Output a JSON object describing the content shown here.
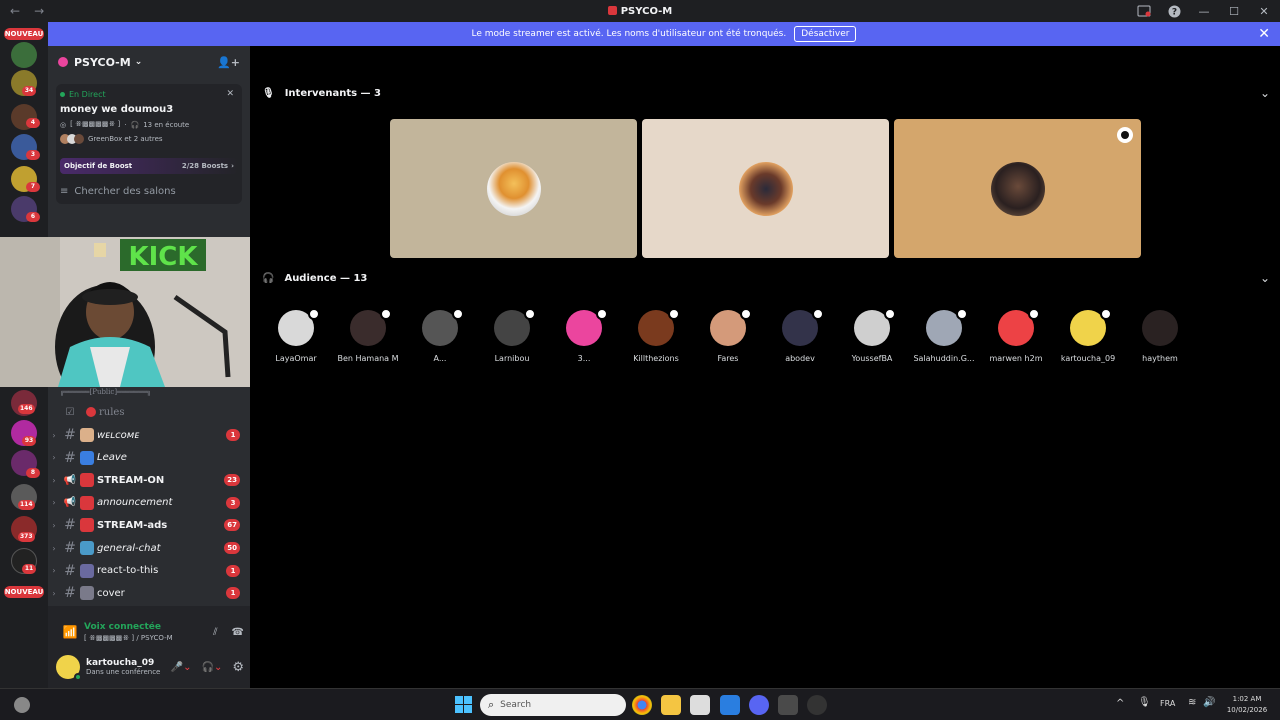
{
  "window": {
    "title": "PSYCO-M"
  },
  "banner": {
    "text": "Le mode streamer est activé. Les noms d'utilisateur ont été tronqués.",
    "button": "Désactiver"
  },
  "guilds": {
    "new_top": "NOUVEAU",
    "new_bottom": "NOUVEAU",
    "badges": [
      "34",
      "4",
      "3",
      "7",
      "6",
      "146",
      "93",
      "8",
      "114",
      "373",
      "11"
    ]
  },
  "server": {
    "name": "PSYCO-M"
  },
  "live": {
    "status": "En Direct",
    "stage_name": "money we doumou3",
    "channel": "[ ꗥ▩▩▩▩ꗥ ]",
    "listeners": "13 en écoute",
    "attendees": "GreenBox et 2 autres"
  },
  "boost": {
    "label": "Objectif de Boost",
    "count": "2/28 Boosts"
  },
  "search": {
    "placeholder": "Chercher des salons"
  },
  "category": "╔══════[Public]═══════╗",
  "rules": "rules",
  "channels": [
    {
      "name": "ᴡᴇʟᴄᴏᴍᴇ",
      "badge": "1",
      "type": "text",
      "style": "italic"
    },
    {
      "name": "Leave",
      "badge": "",
      "type": "text",
      "style": "italic"
    },
    {
      "name": "STREAM-ON",
      "badge": "23",
      "type": "announce",
      "style": "bold"
    },
    {
      "name": "announcement",
      "badge": "3",
      "type": "announce",
      "style": "italic"
    },
    {
      "name": "STREAM-ads",
      "badge": "67",
      "type": "text",
      "style": "bold"
    },
    {
      "name": "general-chat",
      "badge": "50",
      "type": "text",
      "style": "italic"
    },
    {
      "name": "react-to-this",
      "badge": "1",
      "type": "text",
      "style": "normal"
    },
    {
      "name": "cover",
      "badge": "1",
      "type": "text",
      "style": "normal"
    }
  ],
  "voice": {
    "status": "Voix connectée",
    "location": "[ ꗥ▩▩▩▩ꗥ ] / PSYCO-M"
  },
  "user": {
    "name": "kartoucha_09",
    "status": "Dans une conférence"
  },
  "speakers": {
    "header": "Intervenants — 3",
    "tiles": [
      {
        "bg": "#c2b59b"
      },
      {
        "bg": "#e6d8c9"
      },
      {
        "bg": "#d4a66c",
        "moderator": true
      }
    ]
  },
  "audience": {
    "header": "Audience — 13",
    "members": [
      {
        "name": "LayaOmar",
        "color": "#d9d9d9"
      },
      {
        "name": "Ben Hamana M",
        "color": "#3a2c2c"
      },
      {
        "name": "A...",
        "color": "#555555"
      },
      {
        "name": "Larnibou",
        "color": "#444444"
      },
      {
        "name": "3...",
        "color": "#eb459e"
      },
      {
        "name": "Killthezions",
        "color": "#7a3a1e"
      },
      {
        "name": "Fares",
        "color": "#d49a7a"
      },
      {
        "name": "abodev",
        "color": "#33334a"
      },
      {
        "name": "YoussefBA",
        "color": "#cfcfcf"
      },
      {
        "name": "Salahuddin.G...",
        "color": "#9fa7b5"
      },
      {
        "name": "marwen h2m",
        "color": "#ed4245"
      },
      {
        "name": "kartoucha_09",
        "color": "#f0d34a"
      },
      {
        "name": "haythem",
        "color": "#2a2222"
      }
    ]
  },
  "taskbar": {
    "search": "Search",
    "lang": "FRA",
    "time": "1:02 AM",
    "date": "10/02/2026"
  }
}
